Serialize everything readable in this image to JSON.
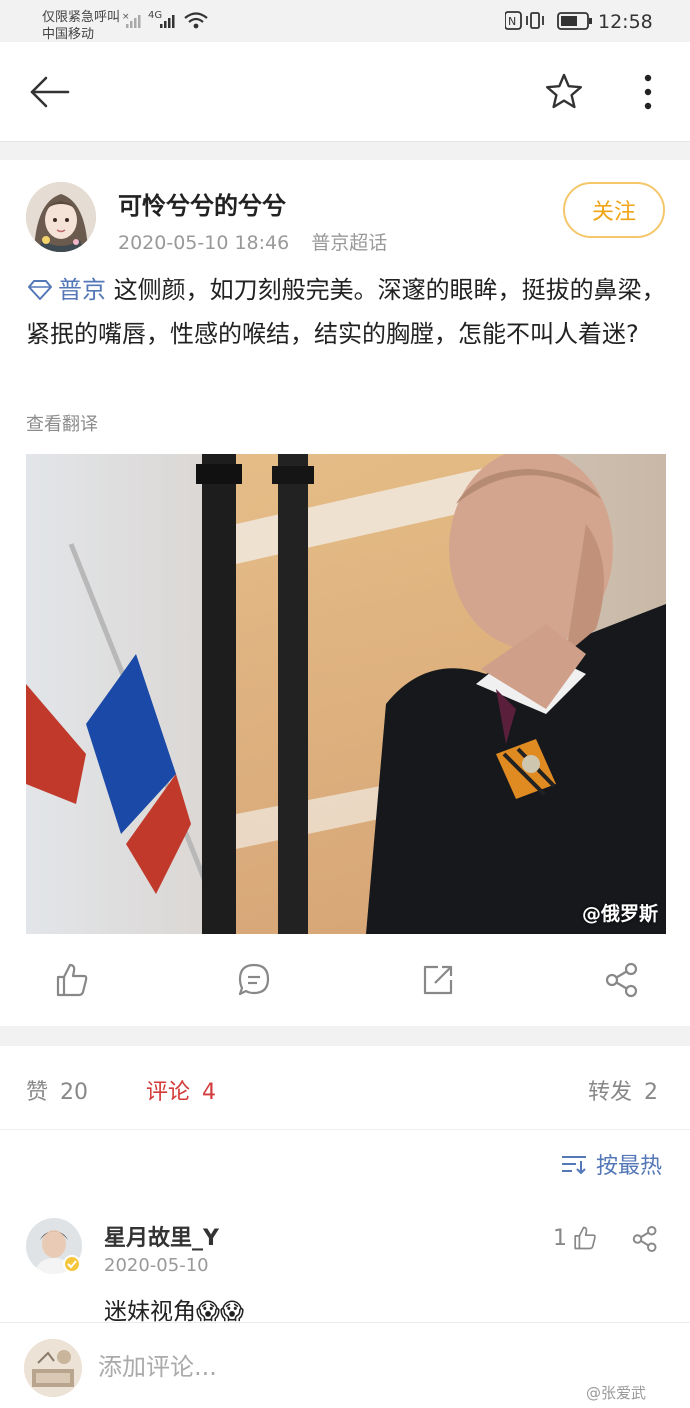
{
  "status_bar": {
    "carrier_line1": "仅限紧急呼叫",
    "carrier_line2": "中国移动",
    "network": "4G",
    "time": "12:58"
  },
  "nav": {
    "back_icon": "back-arrow-icon",
    "star_icon": "star-icon",
    "more_icon": "more-vertical-icon"
  },
  "post": {
    "author": "可怜兮兮的兮兮",
    "date": "2020-05-10 18:46",
    "source": "普京超话",
    "follow_label": "关注",
    "topic": "普京",
    "text": " 这侧颜，如刀刻般完美。深邃的眼眸，挺拔的鼻梁，紧抿的嘴唇，性感的喉结，结实的胸膛，怎能不叫人着迷?",
    "translate_label": "查看翻译",
    "photo_watermark": "@俄罗斯"
  },
  "tabs": {
    "likes_label": "赞",
    "likes_count": "20",
    "comments_label": "评论",
    "comments_count": "4",
    "reposts_label": "转发",
    "reposts_count": "2"
  },
  "sort": {
    "label": "按最热"
  },
  "comments": [
    {
      "name": "星月故里_Y",
      "date": "2020-05-10",
      "text": "迷妹视角😱😱",
      "likes": "1"
    }
  ],
  "bottom": {
    "input_placeholder": "添加评论...",
    "corner_watermark": "@张爱武"
  },
  "colors": {
    "accent_orange": "#f0a417",
    "link_blue": "#5477b7",
    "active_red": "#d33a3a"
  }
}
